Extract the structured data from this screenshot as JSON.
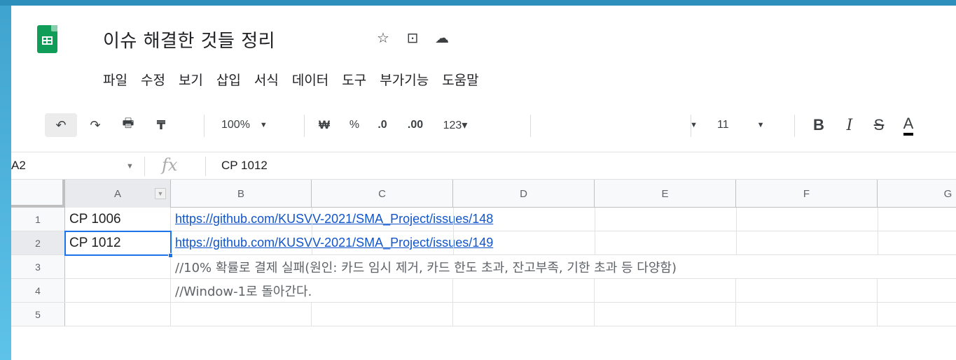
{
  "document": {
    "title": "이슈 해결한 것들 정리",
    "star_icon": "star-icon",
    "move_icon": "move-to-folder-icon",
    "cloud_icon": "cloud-saved-icon"
  },
  "menu": [
    "파일",
    "수정",
    "보기",
    "삽입",
    "서식",
    "데이터",
    "도구",
    "부가기능",
    "도움말"
  ],
  "toolbar": {
    "zoom": "100%",
    "currency": "₩",
    "percent": "%",
    "decrease_decimal": ".0",
    "increase_decimal": ".00",
    "more_formats": "123▾",
    "font_size": "11",
    "bold": "B",
    "italic": "I",
    "strikethrough": "S",
    "text_color": "A"
  },
  "formula_bar": {
    "name_box": "A2",
    "fx": "fx",
    "value": "CP 1012"
  },
  "columns": [
    "A",
    "B",
    "C",
    "D",
    "E",
    "F",
    "G"
  ],
  "rows": [
    {
      "num": "1",
      "a": "CP 1006",
      "b": "https://github.com/KUSVV-2021/SMA_Project/issues/148",
      "b_type": "link"
    },
    {
      "num": "2",
      "a": "CP 1012",
      "b": "https://github.com/KUSVV-2021/SMA_Project/issues/149",
      "b_type": "link"
    },
    {
      "num": "3",
      "a": "",
      "b": "//10% 확률로 결제 실패(원인: 카드 임시 제거, 카드 한도 초과, 잔고부족, 기한 초과 등 다양함)",
      "b_type": "text"
    },
    {
      "num": "4",
      "a": "",
      "b": "//Window-1로 돌아간다.",
      "b_type": "text"
    },
    {
      "num": "5",
      "a": "",
      "b": "",
      "b_type": "text"
    }
  ],
  "selected_cell": "A2",
  "colors": {
    "accent": "#1a73e8",
    "link": "#1155cc",
    "sheets_green": "#0f9d58"
  }
}
